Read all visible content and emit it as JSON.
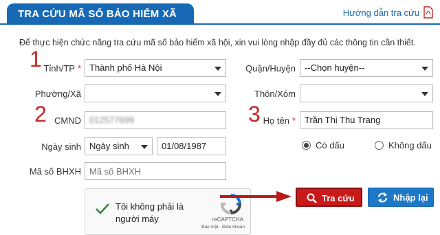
{
  "header": {
    "title": "TRA CỨU MÃ SỐ BẢO HIỂM XÃ HỘI",
    "guide_link": "Hướng dẫn tra cứu"
  },
  "intro": "Để thực hiện chức năng tra cứu mã số bảo hiểm xã hội, xin vui lòng nhập đầy đủ các thông tin cần thiết.",
  "annotations": {
    "n1": "1",
    "n2": "2",
    "n3": "3"
  },
  "form": {
    "province_label": "Tỉnh/TP",
    "province_value": "Thành phố Hà Nội",
    "district_label": "Quận/Huyện",
    "district_value": "--Chọn huyện--",
    "ward_label": "Phường/Xã",
    "ward_value": "",
    "village_label": "Thôn/Xóm",
    "village_value": "",
    "id_label": "CMND",
    "id_value": "012577699",
    "name_label": "Họ tên",
    "name_value": "Trần Thị Thu Trang",
    "dob_label": "Ngày sinh",
    "dob_type_value": "Ngày sinh",
    "dob_value": "01/08/1987",
    "accent_on": "Có dấu",
    "accent_off": "Không dấu",
    "bhxh_label": "Mã số BHXH",
    "bhxh_placeholder": "Mã số BHXH",
    "required_mark": "*"
  },
  "captcha": {
    "text": "Tôi không phải là người máy",
    "brand": "reCAPTCHA",
    "terms": "Bảo mật - Điều khoản"
  },
  "buttons": {
    "search": "Tra cứu",
    "reset": "Nhập lại"
  },
  "colors": {
    "primary": "#1769b5",
    "danger": "#c91a1a",
    "arrow": "#b71c1c"
  }
}
